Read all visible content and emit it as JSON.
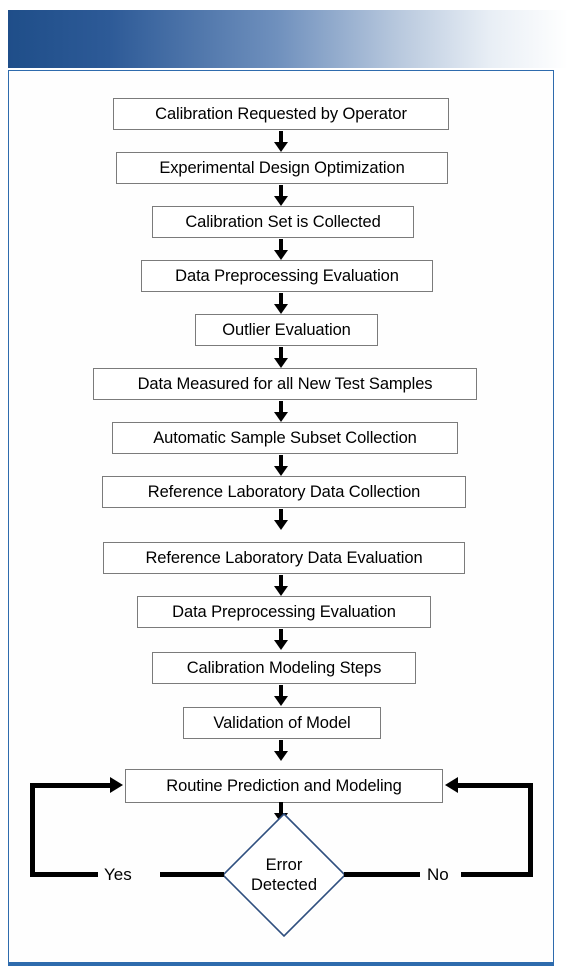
{
  "decoration": {
    "header_band_name": "gradient-header-band",
    "accent_color": "#1f4e89",
    "frame_color": "#2e6bad",
    "box_border_color": "#7b7b7b",
    "diamond_border_color": "#2f4f7f",
    "connector_color": "#000000"
  },
  "flowchart": {
    "type": "flowchart",
    "orientation": "top-to-bottom",
    "steps": [
      {
        "id": "step-1",
        "label": "Calibration Requested by Operator",
        "shape": "process"
      },
      {
        "id": "step-2",
        "label": "Experimental Design Optimization",
        "shape": "process"
      },
      {
        "id": "step-3",
        "label": "Calibration Set is Collected",
        "shape": "process"
      },
      {
        "id": "step-4",
        "label": "Data Preprocessing Evaluation",
        "shape": "process"
      },
      {
        "id": "step-5",
        "label": "Outlier Evaluation",
        "shape": "process"
      },
      {
        "id": "step-6",
        "label": "Data Measured for all New Test Samples",
        "shape": "process"
      },
      {
        "id": "step-7",
        "label": "Automatic Sample Subset Collection",
        "shape": "process"
      },
      {
        "id": "step-8",
        "label": "Reference Laboratory Data Collection",
        "shape": "process"
      },
      {
        "id": "step-9",
        "label": "Reference Laboratory Data Evaluation",
        "shape": "process"
      },
      {
        "id": "step-10",
        "label": "Data Preprocessing Evaluation",
        "shape": "process"
      },
      {
        "id": "step-11",
        "label": "Calibration Modeling Steps",
        "shape": "process"
      },
      {
        "id": "step-12",
        "label": "Validation of Model",
        "shape": "process"
      },
      {
        "id": "step-13",
        "label": "Routine Prediction and Modeling",
        "shape": "process"
      }
    ],
    "decision": {
      "id": "decision-error-detected",
      "shape": "diamond",
      "label_line1": "Error",
      "label_line2": "Detected",
      "branches": [
        {
          "id": "branch-yes",
          "label": "Yes",
          "side": "left",
          "target": "Routine Prediction and Modeling"
        },
        {
          "id": "branch-no",
          "label": "No",
          "side": "right",
          "target": "Routine Prediction and Modeling"
        }
      ]
    }
  }
}
